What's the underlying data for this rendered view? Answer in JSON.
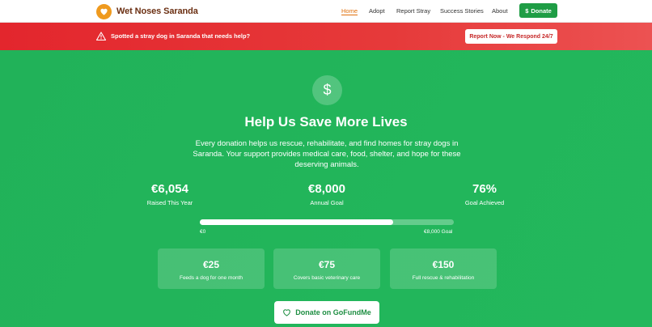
{
  "brand": {
    "name": "Wet Noses Saranda",
    "logo_icon": "heart-icon"
  },
  "nav": {
    "items": [
      {
        "label": "Home",
        "active": true
      },
      {
        "label": "Adopt",
        "active": false
      },
      {
        "label": "Report Stray",
        "active": false
      },
      {
        "label": "Success Stories",
        "active": false
      },
      {
        "label": "About",
        "active": false
      }
    ],
    "donate_label": "Donate",
    "donate_icon": "dollar-icon"
  },
  "alert": {
    "icon": "warning-icon",
    "text": "Spotted a stray dog in Saranda that needs help?",
    "button_label": "Report Now - We Respond 24/7"
  },
  "hero": {
    "icon": "dollar-icon",
    "title": "Help Us Save More Lives",
    "description": "Every donation helps us rescue, rehabilitate, and find homes for stray dogs in Saranda. Your support provides medical care, food, shelter, and hope for these deserving animals."
  },
  "stats": [
    {
      "value": "€6,054",
      "label": "Raised This Year"
    },
    {
      "value": "€8,000",
      "label": "Annual Goal"
    },
    {
      "value": "76%",
      "label": "Goal Achieved"
    }
  ],
  "progress": {
    "fraction": 0.76,
    "min_label": "€0",
    "max_label": "€8,000 Goal"
  },
  "tiers": [
    {
      "amount": "€25",
      "description": "Feeds a dog for one month"
    },
    {
      "amount": "€75",
      "description": "Covers basic veterinary care"
    },
    {
      "amount": "€150",
      "description": "Full rescue & rehabilitation"
    }
  ],
  "cta": {
    "label": "Donate on GoFundMe",
    "icon": "heart-outline-icon"
  },
  "colors": {
    "primary_green": "#22b65a",
    "alert_red": "#e3262d",
    "accent_orange": "#e0700b",
    "brand_brown": "#6b2f12"
  }
}
